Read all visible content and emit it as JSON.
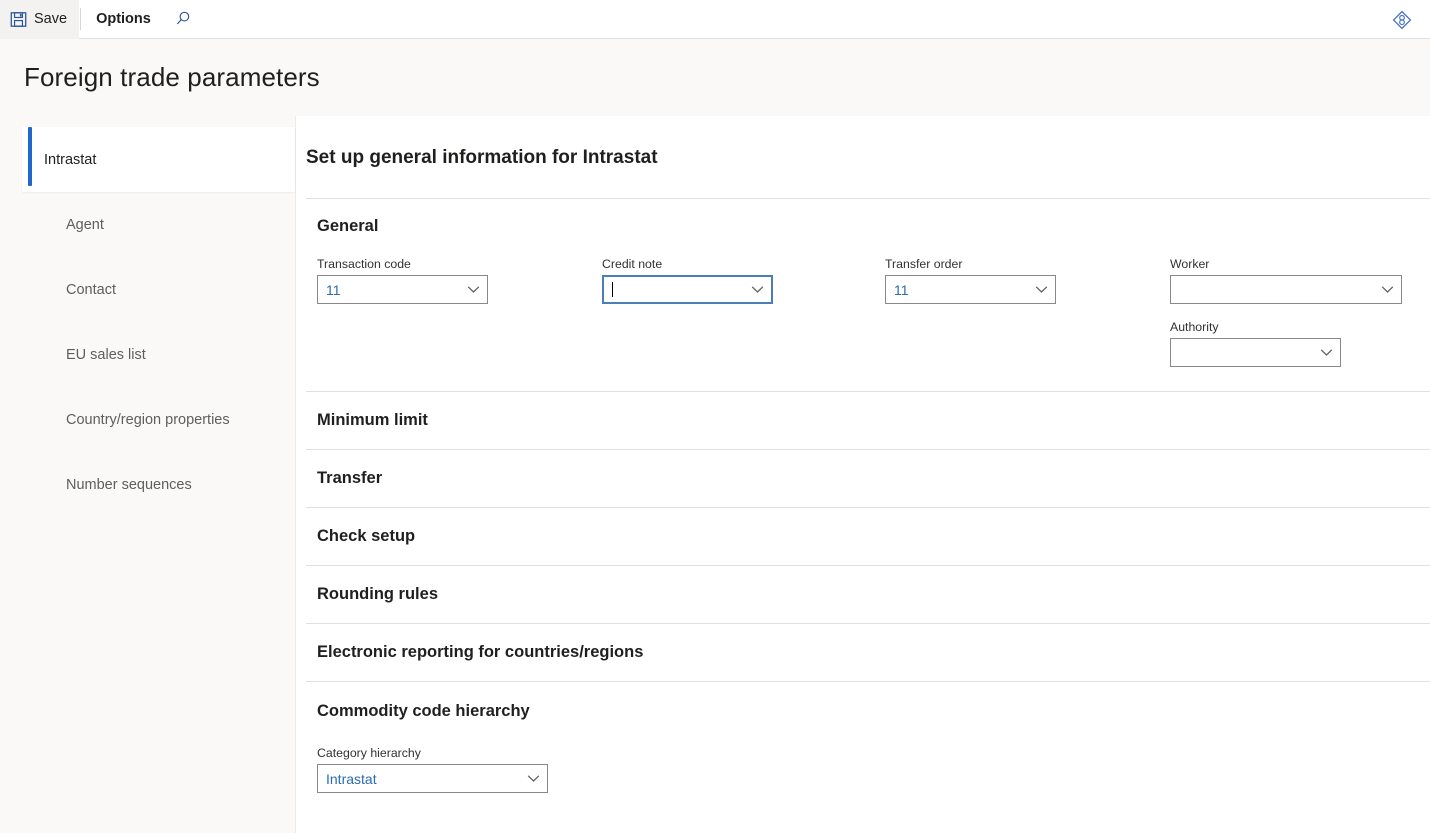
{
  "toolbar": {
    "save_label": "Save",
    "options_label": "Options",
    "save_icon": "save-floppy-icon",
    "search_icon": "search-icon",
    "diagnostics_icon": "task-recorder-diamond-icon"
  },
  "header": {
    "page_title": "Foreign trade parameters"
  },
  "sidebar": {
    "items": [
      {
        "label": "Intrastat",
        "selected": true
      },
      {
        "label": "Agent",
        "selected": false
      },
      {
        "label": "Contact",
        "selected": false
      },
      {
        "label": "EU sales list",
        "selected": false
      },
      {
        "label": "Country/region properties",
        "selected": false
      },
      {
        "label": "Number sequences",
        "selected": false
      }
    ]
  },
  "main": {
    "title": "Set up general information for Intrastat",
    "general": {
      "heading": "General",
      "fields": [
        {
          "label": "Transaction code",
          "value": "11",
          "focused": false,
          "placeholder": ""
        },
        {
          "label": "Credit note",
          "value": "",
          "focused": true,
          "placeholder": ""
        },
        {
          "label": "Transfer order",
          "value": "11",
          "focused": false,
          "placeholder": ""
        },
        {
          "label": "Worker",
          "value": "",
          "focused": false,
          "placeholder": ""
        },
        {
          "label": "Authority",
          "value": "",
          "focused": false,
          "placeholder": ""
        }
      ]
    },
    "collapsed_sections": [
      {
        "label": "Minimum limit"
      },
      {
        "label": "Transfer"
      },
      {
        "label": "Check setup"
      },
      {
        "label": "Rounding rules"
      },
      {
        "label": "Electronic reporting for countries/regions"
      }
    ],
    "commodity": {
      "heading": "Commodity code hierarchy",
      "field": {
        "label": "Category hierarchy",
        "value": "Intrastat"
      }
    }
  },
  "colors": {
    "accent": "#2266cc",
    "value_text": "#2b6cb0",
    "focus_border": "#4a7ebb",
    "header_bg": "#faf9f8",
    "divider": "#e1dfdd"
  }
}
